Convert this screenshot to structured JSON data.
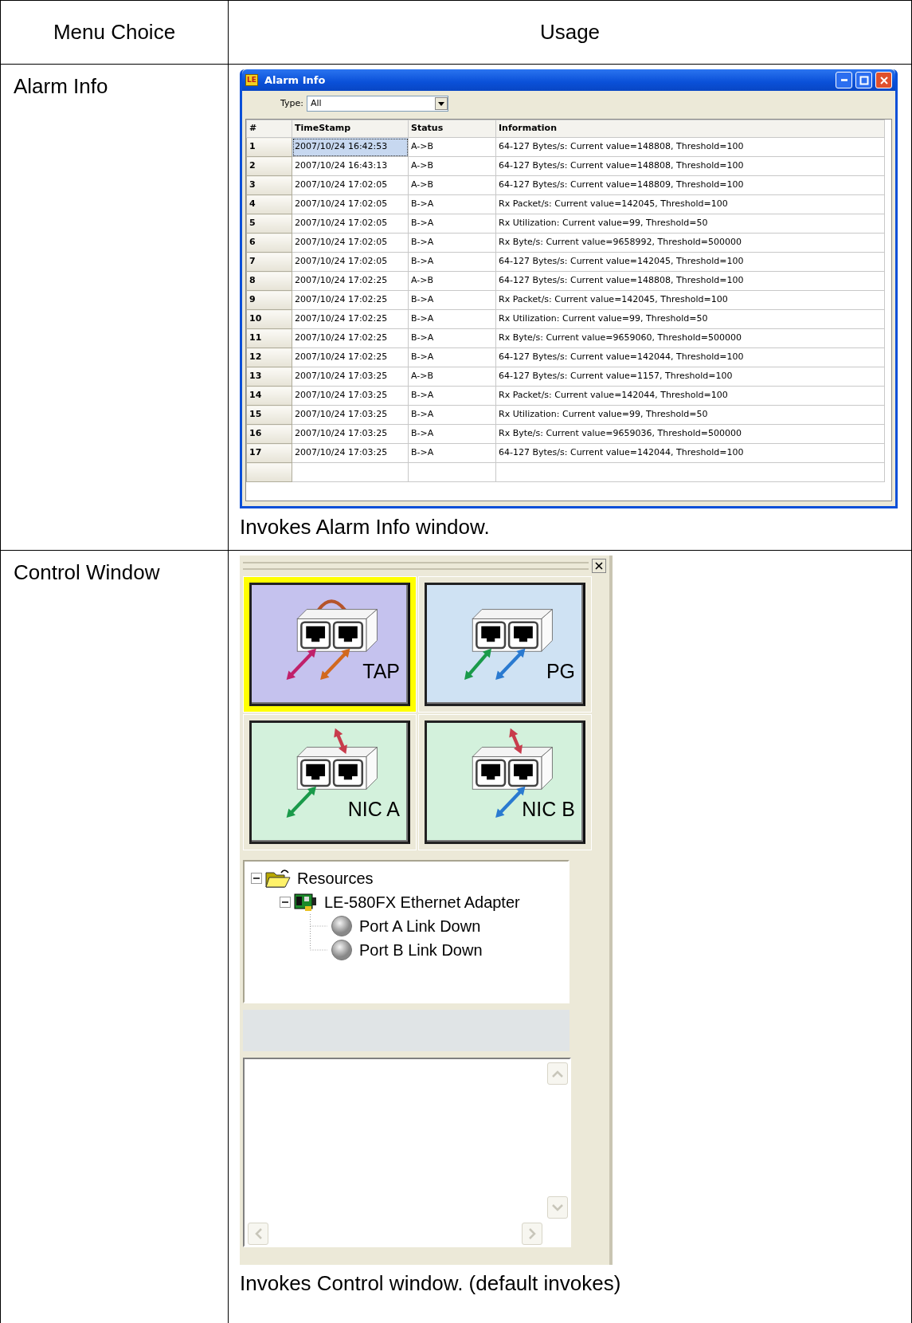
{
  "table": {
    "columns": [
      "Menu Choice",
      "Usage"
    ],
    "rows": [
      {
        "menu_choice": "Alarm Info",
        "window": {
          "kind": "alarm_info",
          "app_icon": "LE",
          "title": "Alarm Info",
          "filter": {
            "label": "Type:",
            "value": "All"
          },
          "grid": {
            "columns": [
              "#",
              "TimeStamp",
              "Status",
              "Information"
            ],
            "rows": [
              {
                "cells": [
                  "1",
                  "2007/10/24 16:42:53",
                  "A->B",
                  "64-127 Bytes/s: Current value=148808, Threshold=100"
                ],
                "selected": true
              },
              {
                "cells": [
                  "2",
                  "2007/10/24 16:43:13",
                  "A->B",
                  "64-127 Bytes/s: Current value=148808, Threshold=100"
                ],
                "selected": false
              },
              {
                "cells": [
                  "3",
                  "2007/10/24 17:02:05",
                  "A->B",
                  "64-127 Bytes/s: Current value=148809, Threshold=100"
                ],
                "selected": false
              },
              {
                "cells": [
                  "4",
                  "2007/10/24 17:02:05",
                  "B->A",
                  "Rx Packet/s: Current value=142045, Threshold=100"
                ],
                "selected": false
              },
              {
                "cells": [
                  "5",
                  "2007/10/24 17:02:05",
                  "B->A",
                  "Rx Utilization: Current value=99, Threshold=50"
                ],
                "selected": false
              },
              {
                "cells": [
                  "6",
                  "2007/10/24 17:02:05",
                  "B->A",
                  "Rx Byte/s: Current value=9658992, Threshold=500000"
                ],
                "selected": false
              },
              {
                "cells": [
                  "7",
                  "2007/10/24 17:02:05",
                  "B->A",
                  "64-127 Bytes/s: Current value=142045, Threshold=100"
                ],
                "selected": false
              },
              {
                "cells": [
                  "8",
                  "2007/10/24 17:02:25",
                  "A->B",
                  "64-127 Bytes/s: Current value=148808, Threshold=100"
                ],
                "selected": false
              },
              {
                "cells": [
                  "9",
                  "2007/10/24 17:02:25",
                  "B->A",
                  "Rx Packet/s: Current value=142045, Threshold=100"
                ],
                "selected": false
              },
              {
                "cells": [
                  "10",
                  "2007/10/24 17:02:25",
                  "B->A",
                  "Rx Utilization: Current value=99, Threshold=50"
                ],
                "selected": false
              },
              {
                "cells": [
                  "11",
                  "2007/10/24 17:02:25",
                  "B->A",
                  "Rx Byte/s: Current value=9659060, Threshold=500000"
                ],
                "selected": false
              },
              {
                "cells": [
                  "12",
                  "2007/10/24 17:02:25",
                  "B->A",
                  "64-127 Bytes/s: Current value=142044, Threshold=100"
                ],
                "selected": false
              },
              {
                "cells": [
                  "13",
                  "2007/10/24 17:03:25",
                  "A->B",
                  "64-127 Bytes/s: Current value=1157, Threshold=100"
                ],
                "selected": false
              },
              {
                "cells": [
                  "14",
                  "2007/10/24 17:03:25",
                  "B->A",
                  "Rx Packet/s: Current value=142044, Threshold=100"
                ],
                "selected": false
              },
              {
                "cells": [
                  "15",
                  "2007/10/24 17:03:25",
                  "B->A",
                  "Rx Utilization: Current value=99, Threshold=50"
                ],
                "selected": false
              },
              {
                "cells": [
                  "16",
                  "2007/10/24 17:03:25",
                  "B->A",
                  "Rx Byte/s: Current value=9659036, Threshold=500000"
                ],
                "selected": false
              },
              {
                "cells": [
                  "17",
                  "2007/10/24 17:03:25",
                  "B->A",
                  "64-127 Bytes/s: Current value=142044, Threshold=100"
                ],
                "selected": false
              }
            ]
          }
        },
        "description": "Invokes Alarm Info window."
      },
      {
        "menu_choice": "Control Window",
        "window": {
          "kind": "control",
          "modes": [
            {
              "label": "TAP",
              "kind": "tap",
              "color": "#c5c2ee",
              "selected": true
            },
            {
              "label": "PG",
              "kind": "pg",
              "color": "#cfe2f3",
              "selected": false
            },
            {
              "label": "NIC A",
              "kind": "nic_a",
              "color": "#d3f1dc",
              "selected": false
            },
            {
              "label": "NIC B",
              "kind": "nic_b",
              "color": "#d3f1dc",
              "selected": false
            }
          ],
          "tree": [
            {
              "label": "Resources",
              "kind": "folder",
              "expanded": true,
              "children": [
                {
                  "label": "LE-580FX Ethernet Adapter",
                  "kind": "adapter",
                  "expanded": true,
                  "children": [
                    {
                      "label": "Port A Link Down",
                      "kind": "port"
                    },
                    {
                      "label": "Port B Link Down",
                      "kind": "port"
                    }
                  ]
                }
              ]
            }
          ]
        },
        "description": "Invokes Control window. (default invokes)"
      }
    ]
  }
}
